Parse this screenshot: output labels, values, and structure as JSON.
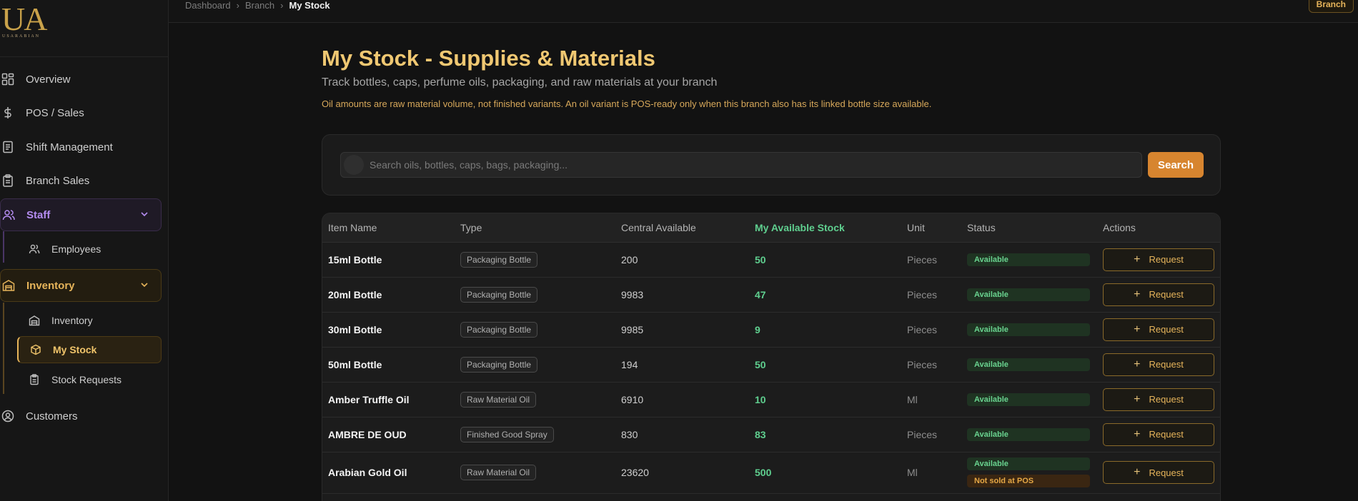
{
  "brand": {
    "mark": "UA",
    "sub": "USARABIAN"
  },
  "breadcrumb": {
    "items": [
      "Dashboard",
      "Branch"
    ],
    "current": "My Stock"
  },
  "branch_tag": "Branch",
  "sidebar": {
    "items": [
      {
        "label": "Overview",
        "icon": "grid-icon"
      },
      {
        "label": "POS / Sales",
        "icon": "dollar-icon"
      },
      {
        "label": "Shift Management",
        "icon": "document-icon"
      },
      {
        "label": "Branch Sales",
        "icon": "clipboard-icon"
      }
    ],
    "staff": {
      "label": "Staff",
      "children": [
        {
          "label": "Employees"
        }
      ]
    },
    "inventory": {
      "label": "Inventory",
      "children": [
        {
          "label": "Inventory"
        },
        {
          "label": "My Stock"
        },
        {
          "label": "Stock Requests"
        }
      ]
    },
    "customers": {
      "label": "Customers"
    }
  },
  "page": {
    "title": "My Stock - Supplies & Materials",
    "subtitle": "Track bottles, caps, perfume oils, packaging, and raw materials at your branch",
    "note": "Oil amounts are raw material volume, not finished variants. An oil variant is POS-ready only when this branch also has its linked bottle size available."
  },
  "search": {
    "placeholder": "Search oils, bottles, caps, bags, packaging...",
    "button": "Search"
  },
  "table": {
    "headers": [
      "Item Name",
      "Type",
      "Central Available",
      "My Available Stock",
      "Unit",
      "Status",
      "Actions"
    ],
    "action_label": "Request",
    "rows": [
      {
        "name": "15ml Bottle",
        "type": "Packaging Bottle",
        "central": "200",
        "mine": "50",
        "unit": "Pieces",
        "status": "Available"
      },
      {
        "name": "20ml Bottle",
        "type": "Packaging Bottle",
        "central": "9983",
        "mine": "47",
        "unit": "Pieces",
        "status": "Available"
      },
      {
        "name": "30ml Bottle",
        "type": "Packaging Bottle",
        "central": "9985",
        "mine": "9",
        "unit": "Pieces",
        "status": "Available"
      },
      {
        "name": "50ml Bottle",
        "type": "Packaging Bottle",
        "central": "194",
        "mine": "50",
        "unit": "Pieces",
        "status": "Available"
      },
      {
        "name": "Amber Truffle Oil",
        "type": "Raw Material Oil",
        "central": "6910",
        "mine": "10",
        "unit": "Ml",
        "status": "Available"
      },
      {
        "name": "AMBRE DE OUD",
        "type": "Finished Good Spray",
        "central": "830",
        "mine": "83",
        "unit": "Pieces",
        "status": "Available"
      },
      {
        "name": "Arabian Gold Oil",
        "type": "Raw Material Oil",
        "central": "23620",
        "mine": "500",
        "unit": "Ml",
        "status": "Available",
        "status2": "Not sold at POS"
      }
    ]
  },
  "colors": {
    "accent": "#f0c872",
    "brand_orange": "#d7852f",
    "available_green": "#5fcf8f"
  }
}
